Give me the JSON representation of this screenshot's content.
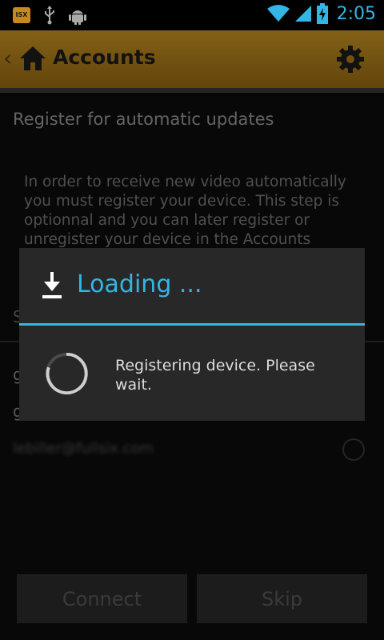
{
  "status_bar": {
    "time": "2:05",
    "app_icon_text": "ISX"
  },
  "action_bar": {
    "title": "Accounts"
  },
  "content": {
    "section_title": "Register for automatic updates",
    "body_text": "In order to receive new video automatically you must register your device. This step is optionnal and you can later register or unregister your device in the Accounts",
    "sub_heading_partial": "S",
    "account_row_1": "g",
    "account_row_2": "g",
    "account_email": "lebiller@fullsix.com"
  },
  "buttons": {
    "connect": "Connect",
    "skip": "Skip"
  },
  "dialog": {
    "title": "Loading ...",
    "message": "Registering device. Please wait."
  },
  "colors": {
    "accent": "#33b5e5",
    "action_bar": "#c99524"
  }
}
